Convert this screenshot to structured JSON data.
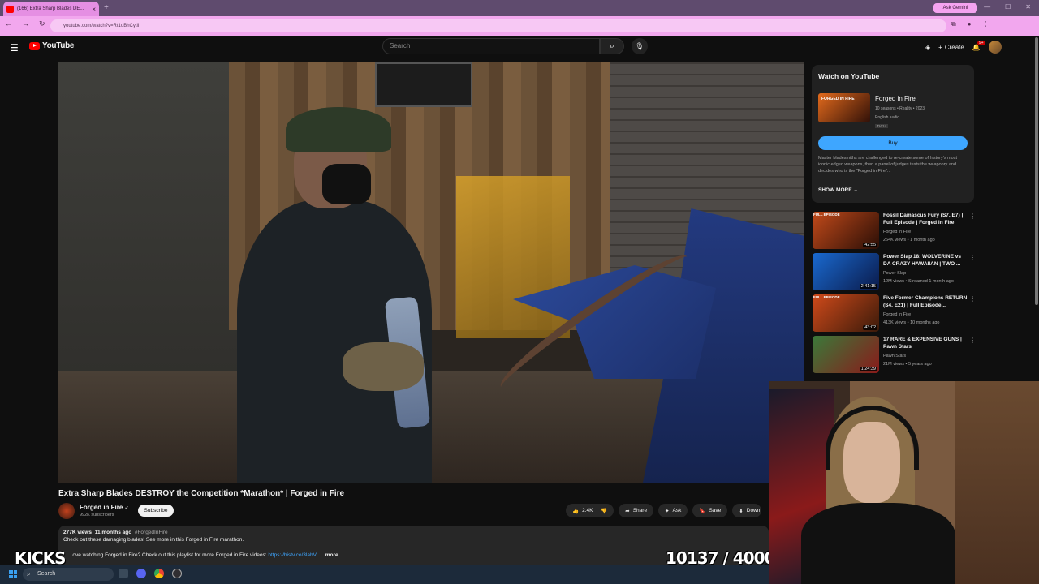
{
  "browser": {
    "tab_title": "(166) Extra Sharp Blades DE...",
    "tab_close": "×",
    "new_tab": "+",
    "ask_gemini": "Ask Gemini",
    "url": "youtube.com/watch?v=Rt1oBhCytlI",
    "win_controls": [
      "—",
      "☐",
      "✕"
    ]
  },
  "header": {
    "logo_text": "YouTube",
    "search_placeholder": "Search",
    "create_label": "Create",
    "notif_count": "9+"
  },
  "video": {
    "title": "Extra Sharp Blades DESTROY the Competition *Marathon* | Forged in Fire",
    "channel": "Forged in Fire",
    "subscribers": "992K subscribers",
    "subscribe_label": "Subscribe",
    "likes": "2.4K",
    "share_label": "Share",
    "ask_label": "Ask",
    "save_label": "Save",
    "download_label": "Down"
  },
  "description": {
    "views": "277K views",
    "age": "11 months ago",
    "tag": "#ForgedInFire",
    "line1": "Check out these damaging blades! See more in this Forged in Fire marathon.",
    "line2": "...ove watching Forged in Fire? Check out this playlist for more Forged in Fire videos:",
    "link": "https://histv.co/3lahV",
    "more_label": "...more"
  },
  "overlay": {
    "left": "KICKS",
    "counter": "10137 / 40000"
  },
  "watch_card": {
    "heading": "Watch on YouTube",
    "thumb_text": "FORGED IN FIRE",
    "show": "Forged in Fire",
    "meta1": "10 seasons • Reality • 2023",
    "meta2": "English audio",
    "rating": "TV-14",
    "buy_label": "Buy",
    "blurb": "Master bladesmiths are challenged to re-create some of history's most iconic edged weapons, then a panel of judges tests the weaponry and decides who is the \"Forged in Fire\"...",
    "show_more": "SHOW MORE"
  },
  "recommendations": [
    {
      "badge": "FULL EPISODE",
      "title": "Fossil Damascus Fury (S7, E7) | Full Episode | Forged in Fire",
      "channel": "Forged in Fire",
      "views": "264K views • 1 month ago",
      "duration": "42:55",
      "color1": "#c24a1a",
      "color2": "#2a0e06"
    },
    {
      "badge": "",
      "title": "Power Slap 18: WOLVERINE vs DA CRAZY HAWAIIAN | TWO ...",
      "channel": "Power Slap",
      "views": "12M views • Streamed 1 month ago",
      "duration": "2:41:15",
      "color1": "#1a6ad0",
      "color2": "#0a1a4a"
    },
    {
      "badge": "FULL EPISODE",
      "title": "Five Former Champions RETURN (S4, E21) | Full Episode...",
      "channel": "Forged in Fire",
      "views": "413K views • 10 months ago",
      "duration": "43:02",
      "color1": "#d04a1a",
      "color2": "#3a1a0a"
    },
    {
      "badge": "",
      "title": "17 RARE & EXPENSIVE GUNS | Pawn Stars",
      "channel": "Pawn Stars",
      "views": "21M views • 5 years ago",
      "duration": "1:24:39",
      "color1": "#3a7a3a",
      "color2": "#8a1a1a"
    }
  ],
  "taskbar": {
    "search_label": "Search"
  }
}
